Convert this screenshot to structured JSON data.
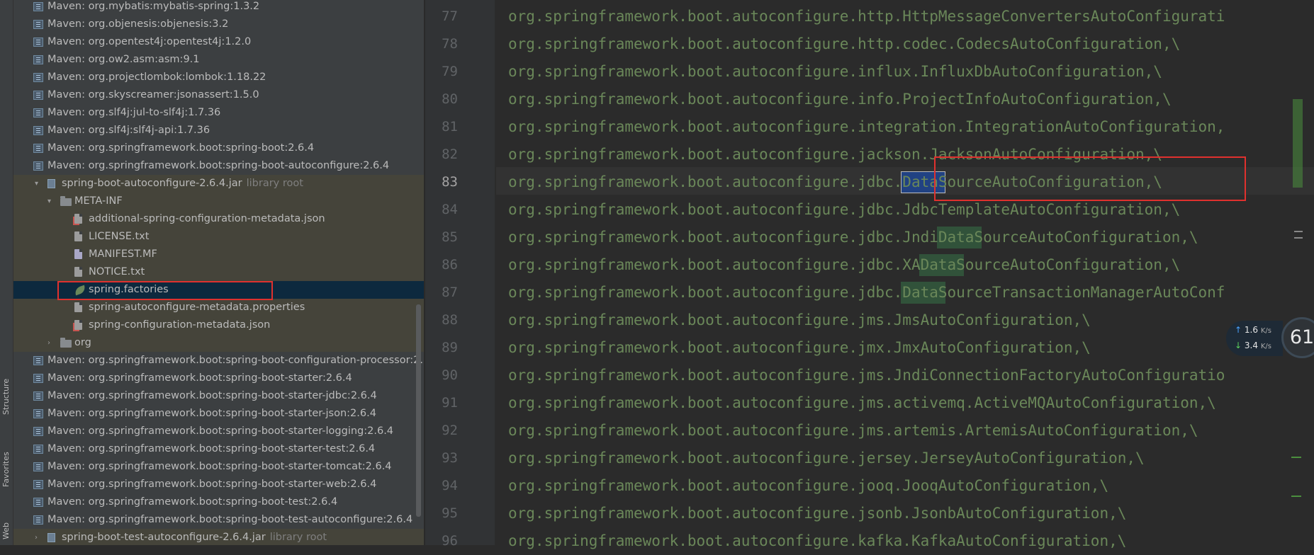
{
  "tool_windows": {
    "structure": "Structure",
    "favorites": "Favorites",
    "web": "Web"
  },
  "project_tree": [
    {
      "label": "Maven: org.mybatis:mybatis-spring:1.3.2",
      "muted": "",
      "icon": "library-icon",
      "indent": 0,
      "arrow": "",
      "style": ""
    },
    {
      "label": "Maven: org.objenesis:objenesis:3.2",
      "muted": "",
      "icon": "library-icon",
      "indent": 0,
      "arrow": "",
      "style": ""
    },
    {
      "label": "Maven: org.opentest4j:opentest4j:1.2.0",
      "muted": "",
      "icon": "library-icon",
      "indent": 0,
      "arrow": "",
      "style": ""
    },
    {
      "label": "Maven: org.ow2.asm:asm:9.1",
      "muted": "",
      "icon": "library-icon",
      "indent": 0,
      "arrow": "",
      "style": ""
    },
    {
      "label": "Maven: org.projectlombok:lombok:1.18.22",
      "muted": "",
      "icon": "library-icon",
      "indent": 0,
      "arrow": "",
      "style": ""
    },
    {
      "label": "Maven: org.skyscreamer:jsonassert:1.5.0",
      "muted": "",
      "icon": "library-icon",
      "indent": 0,
      "arrow": "",
      "style": ""
    },
    {
      "label": "Maven: org.slf4j:jul-to-slf4j:1.7.36",
      "muted": "",
      "icon": "library-icon",
      "indent": 0,
      "arrow": "",
      "style": ""
    },
    {
      "label": "Maven: org.slf4j:slf4j-api:1.7.36",
      "muted": "",
      "icon": "library-icon",
      "indent": 0,
      "arrow": "",
      "style": ""
    },
    {
      "label": "Maven: org.springframework.boot:spring-boot:2.6.4",
      "muted": "",
      "icon": "library-icon",
      "indent": 0,
      "arrow": "",
      "style": ""
    },
    {
      "label": "Maven: org.springframework.boot:spring-boot-autoconfigure:2.6.4",
      "muted": "",
      "icon": "library-icon",
      "indent": 0,
      "arrow": "",
      "style": ""
    },
    {
      "label": "spring-boot-autoconfigure-2.6.4.jar",
      "muted": "library root",
      "icon": "jar-icon",
      "indent": 1,
      "arrow": "▾",
      "style": "lib"
    },
    {
      "label": "META-INF",
      "muted": "",
      "icon": "folder-icon",
      "indent": 2,
      "arrow": "▾",
      "style": "lib"
    },
    {
      "label": "additional-spring-configuration-metadata.json",
      "muted": "",
      "icon": "json-file-icon",
      "indent": 3,
      "arrow": "",
      "style": "lib"
    },
    {
      "label": "LICENSE.txt",
      "muted": "",
      "icon": "text-file-icon",
      "indent": 3,
      "arrow": "",
      "style": "lib"
    },
    {
      "label": "MANIFEST.MF",
      "muted": "",
      "icon": "manifest-file-icon",
      "indent": 3,
      "arrow": "",
      "style": "lib"
    },
    {
      "label": "NOTICE.txt",
      "muted": "",
      "icon": "text-file-icon",
      "indent": 3,
      "arrow": "",
      "style": "lib"
    },
    {
      "label": "spring.factories",
      "muted": "",
      "icon": "spring-leaf-icon",
      "indent": 3,
      "arrow": "",
      "style": "sel"
    },
    {
      "label": "spring-autoconfigure-metadata.properties",
      "muted": "",
      "icon": "properties-file-icon",
      "indent": 3,
      "arrow": "",
      "style": "lib"
    },
    {
      "label": "spring-configuration-metadata.json",
      "muted": "",
      "icon": "json-file-icon",
      "indent": 3,
      "arrow": "",
      "style": "lib"
    },
    {
      "label": "org",
      "muted": "",
      "icon": "folder-icon",
      "indent": 2,
      "arrow": "›",
      "style": "lib"
    },
    {
      "label": "Maven: org.springframework.boot:spring-boot-configuration-processor:2.",
      "muted": "",
      "icon": "library-icon",
      "indent": 0,
      "arrow": "",
      "style": ""
    },
    {
      "label": "Maven: org.springframework.boot:spring-boot-starter:2.6.4",
      "muted": "",
      "icon": "library-icon",
      "indent": 0,
      "arrow": "",
      "style": ""
    },
    {
      "label": "Maven: org.springframework.boot:spring-boot-starter-jdbc:2.6.4",
      "muted": "",
      "icon": "library-icon",
      "indent": 0,
      "arrow": "",
      "style": ""
    },
    {
      "label": "Maven: org.springframework.boot:spring-boot-starter-json:2.6.4",
      "muted": "",
      "icon": "library-icon",
      "indent": 0,
      "arrow": "",
      "style": ""
    },
    {
      "label": "Maven: org.springframework.boot:spring-boot-starter-logging:2.6.4",
      "muted": "",
      "icon": "library-icon",
      "indent": 0,
      "arrow": "",
      "style": ""
    },
    {
      "label": "Maven: org.springframework.boot:spring-boot-starter-test:2.6.4",
      "muted": "",
      "icon": "library-icon",
      "indent": 0,
      "arrow": "",
      "style": ""
    },
    {
      "label": "Maven: org.springframework.boot:spring-boot-starter-tomcat:2.6.4",
      "muted": "",
      "icon": "library-icon",
      "indent": 0,
      "arrow": "",
      "style": ""
    },
    {
      "label": "Maven: org.springframework.boot:spring-boot-starter-web:2.6.4",
      "muted": "",
      "icon": "library-icon",
      "indent": 0,
      "arrow": "",
      "style": ""
    },
    {
      "label": "Maven: org.springframework.boot:spring-boot-test:2.6.4",
      "muted": "",
      "icon": "library-icon",
      "indent": 0,
      "arrow": "",
      "style": ""
    },
    {
      "label": "Maven: org.springframework.boot:spring-boot-test-autoconfigure:2.6.4",
      "muted": "",
      "icon": "library-icon",
      "indent": 0,
      "arrow": "",
      "style": ""
    },
    {
      "label": "spring-boot-test-autoconfigure-2.6.4.jar",
      "muted": "library root",
      "icon": "jar-icon",
      "indent": 1,
      "arrow": "›",
      "style": "lib"
    }
  ],
  "editor": {
    "current_line": 83,
    "lines": [
      {
        "n": 77,
        "text": "org.springframework.boot.autoconfigure.http.HttpMessageConvertersAutoConfigurati"
      },
      {
        "n": 78,
        "text": "org.springframework.boot.autoconfigure.http.codec.CodecsAutoConfiguration,\\"
      },
      {
        "n": 79,
        "text": "org.springframework.boot.autoconfigure.influx.InfluxDbAutoConfiguration,\\"
      },
      {
        "n": 80,
        "text": "org.springframework.boot.autoconfigure.info.ProjectInfoAutoConfiguration,\\"
      },
      {
        "n": 81,
        "text": "org.springframework.boot.autoconfigure.integration.IntegrationAutoConfiguration,"
      },
      {
        "n": 82,
        "text": "org.springframework.boot.autoconfigure.jackson.JacksonAutoConfiguration,\\"
      },
      {
        "n": 83,
        "text": "org.springframework.boot.autoconfigure.jdbc.DataSourceAutoConfiguration,\\"
      },
      {
        "n": 84,
        "text": "org.springframework.boot.autoconfigure.jdbc.JdbcTemplateAutoConfiguration,\\"
      },
      {
        "n": 85,
        "text": "org.springframework.boot.autoconfigure.jdbc.JndiDataSourceAutoConfiguration,\\"
      },
      {
        "n": 86,
        "text": "org.springframework.boot.autoconfigure.jdbc.XADataSourceAutoConfiguration,\\"
      },
      {
        "n": 87,
        "text": "org.springframework.boot.autoconfigure.jdbc.DataSourceTransactionManagerAutoConf"
      },
      {
        "n": 88,
        "text": "org.springframework.boot.autoconfigure.jms.JmsAutoConfiguration,\\"
      },
      {
        "n": 89,
        "text": "org.springframework.boot.autoconfigure.jmx.JmxAutoConfiguration,\\"
      },
      {
        "n": 90,
        "text": "org.springframework.boot.autoconfigure.jms.JndiConnectionFactoryAutoConfiguratio"
      },
      {
        "n": 91,
        "text": "org.springframework.boot.autoconfigure.jms.activemq.ActiveMQAutoConfiguration,\\"
      },
      {
        "n": 92,
        "text": "org.springframework.boot.autoconfigure.jms.artemis.ArtemisAutoConfiguration,\\"
      },
      {
        "n": 93,
        "text": "org.springframework.boot.autoconfigure.jersey.JerseyAutoConfiguration,\\"
      },
      {
        "n": 94,
        "text": "org.springframework.boot.autoconfigure.jooq.JooqAutoConfiguration,\\"
      },
      {
        "n": 95,
        "text": "org.springframework.boot.autoconfigure.jsonb.JsonbAutoConfiguration,\\"
      },
      {
        "n": 96,
        "text": "org.springframework.boot.autoconfigure.kafka.KafkaAutoConfiguration,\\"
      }
    ]
  },
  "net_monitor": {
    "upload": "1.6",
    "download": "3.4",
    "unit": "K/s",
    "cpu": "61"
  },
  "colors": {
    "string_green": "#6a8759",
    "selection_blue": "#214283",
    "occurrence_green": "#32593d",
    "annotation_red": "#e0312e"
  }
}
